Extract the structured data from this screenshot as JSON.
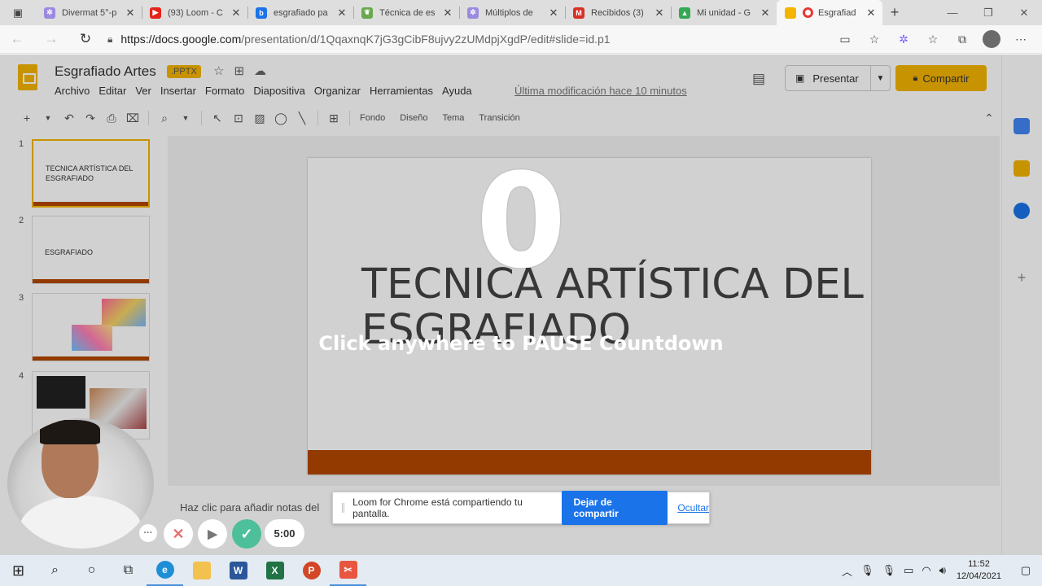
{
  "browser": {
    "tabs": [
      {
        "label": "Divermat 5°-p",
        "icon": "gear-favicon",
        "color": "#9b8ae0"
      },
      {
        "label": "(93) Loom - C",
        "icon": "youtube-favicon",
        "color": "#e62117"
      },
      {
        "label": "esgrafiado pa",
        "icon": "bing-favicon",
        "color": "#1a73e8"
      },
      {
        "label": "Técnica de es",
        "icon": "leaf-favicon",
        "color": "#6aa84f"
      },
      {
        "label": "Múltiplos de",
        "icon": "gear-favicon",
        "color": "#9b8ae0"
      },
      {
        "label": "Recibidos (3)",
        "icon": "gmail-favicon",
        "color": "#d93025"
      },
      {
        "label": "Mi unidad - G",
        "icon": "drive-favicon",
        "color": "#34a853"
      },
      {
        "label": "Esgrafiad",
        "icon": "slides-favicon",
        "color": "#f4b400",
        "active": true
      }
    ],
    "url_host": "https://docs.google.com",
    "url_path": "/presentation/d/1QqaxnqK7jG3gCibF8ujvy2zUMdpjXgdP/edit#slide=id.p1"
  },
  "slides": {
    "doc_title": "Esgrafiado Artes",
    "badge": ".PPTX",
    "menu": [
      "Archivo",
      "Editar",
      "Ver",
      "Insertar",
      "Formato",
      "Diapositiva",
      "Organizar",
      "Herramientas",
      "Ayuda"
    ],
    "last_edit": "Última modificación hace 10 minutos",
    "present_label": "Presentar",
    "share_label": "Compartir",
    "toolbar_text": [
      "Fondo",
      "Diseño",
      "Tema",
      "Transición"
    ],
    "thumbnails": [
      {
        "number": "1",
        "text": "TECNICA ARTÍSTICA DEL ESGRAFIADO"
      },
      {
        "number": "2",
        "text": "ESGRAFIADO"
      },
      {
        "number": "3",
        "text": ""
      },
      {
        "number": "4",
        "text": ""
      }
    ],
    "slide_title_line1": "TECNICA ARTÍSTICA DEL",
    "slide_title_line2": "ESGRAFIADO",
    "notes_placeholder": "Haz clic para añadir notas del"
  },
  "loom": {
    "countdown": "0",
    "pause_hint": "Click anywhere to PAUSE Countdown",
    "share_message": "Loom for Chrome está compartiendo tu pantalla.",
    "stop_label": "Dejar de compartir",
    "hide_label": "Ocultar",
    "timer": "5:00"
  },
  "taskbar": {
    "time": "11:52",
    "date": "12/04/2021"
  },
  "colors": {
    "slides_accent": "#f4b400",
    "slide_bar": "#b34700",
    "loom_done": "#4dbf9b",
    "loom_stop": "#1a73e8"
  }
}
